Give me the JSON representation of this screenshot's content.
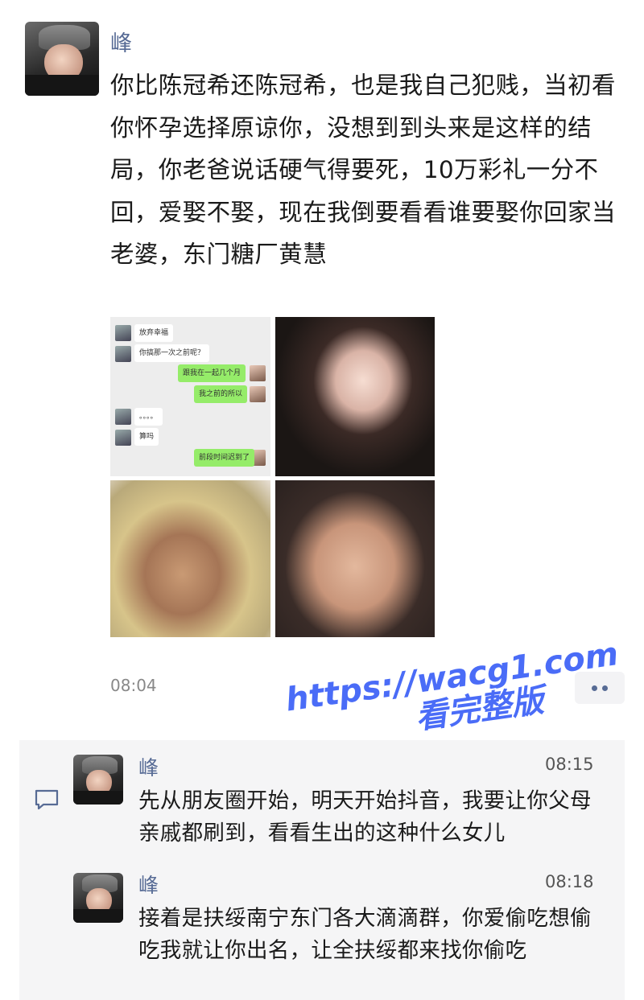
{
  "post": {
    "author": "峰",
    "text": "你比陈冠希还陈冠希，也是我自己犯贱，当初看你怀孕选择原谅你，没想到到头来是这样的结局，你老爸说话硬气得要死，10万彩礼一分不回，爱娶不娶，现在我倒要看看谁要娶你回家当老婆，东门糖厂黄慧",
    "time": "08:04",
    "more_icon": "more-dots-icon"
  },
  "chat_screenshot": {
    "rows": [
      {
        "side": "in",
        "text": "放弃幸福"
      },
      {
        "side": "in",
        "text": "你搞那一次之前呢？"
      },
      {
        "side": "out",
        "text": "跟我在一起几个月"
      },
      {
        "side": "out",
        "text": "我之前的所以"
      },
      {
        "side": "in",
        "text": "。。。。"
      },
      {
        "side": "in",
        "text": "算吗"
      },
      {
        "side": "out",
        "text": "前段时间迟到了"
      }
    ]
  },
  "watermark": {
    "line1": "https://wacg1.com",
    "line2": "看完整版",
    "color": "#4a6cf7"
  },
  "comments": [
    {
      "author": "峰",
      "time": "08:15",
      "text": "先从朋友圈开始，明天开始抖音，我要让你父母亲戚都刷到，看看生出的这种什么女儿"
    },
    {
      "author": "峰",
      "time": "08:18",
      "text": "接着是扶绥南宁东门各大滴滴群，你爱偷吃想偷吃我就让你出名，让全扶绥都来找你偷吃"
    }
  ],
  "colors": {
    "name": "#576b95",
    "comment_bg": "#f5f5f6",
    "bubble_out": "#95ec69"
  }
}
